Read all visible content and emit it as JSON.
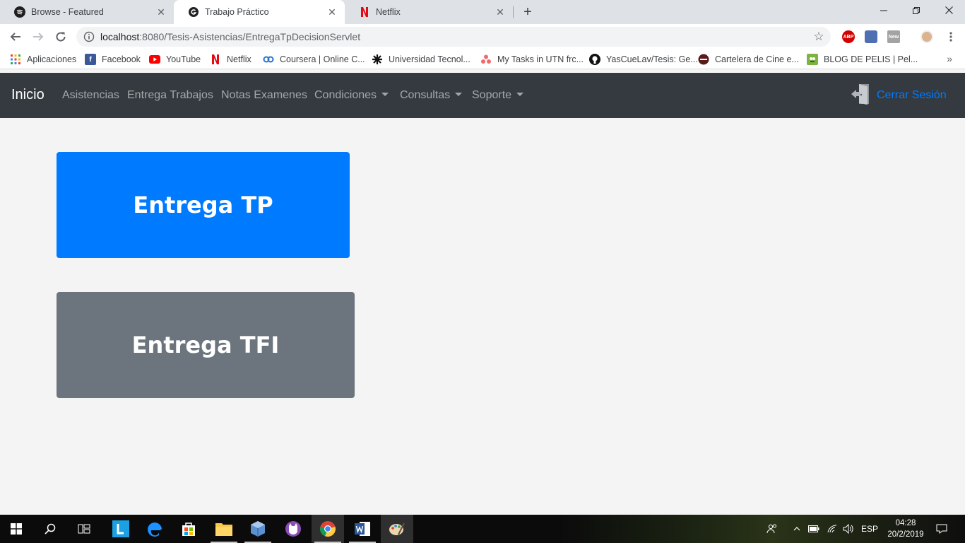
{
  "browser": {
    "tabs": [
      {
        "title": "Browse - Featured",
        "icon": "spotify-icon",
        "active": false
      },
      {
        "title": "Trabajo Práctico",
        "icon": "page-icon",
        "active": true
      },
      {
        "title": "Netflix",
        "icon": "netflix-icon",
        "active": false
      }
    ],
    "url_host": "localhost",
    "url_rest": ":8080/Tesis-Asistencias/EntregaTpDecisionServlet",
    "bookmarks": [
      {
        "label": "Aplicaciones",
        "icon": "apps-grid-icon"
      },
      {
        "label": "Facebook",
        "icon": "facebook-icon"
      },
      {
        "label": "YouTube",
        "icon": "youtube-icon"
      },
      {
        "label": "Netflix",
        "icon": "netflix-icon"
      },
      {
        "label": "Coursera | Online C...",
        "icon": "coursera-icon"
      },
      {
        "label": "Universidad Tecnol...",
        "icon": "utn-icon"
      },
      {
        "label": "My Tasks in UTN frc...",
        "icon": "asana-icon"
      },
      {
        "label": "YasCueLav/Tesis: Ge...",
        "icon": "github-icon"
      },
      {
        "label": "Cartelera de Cine e...",
        "icon": "cinema-icon"
      },
      {
        "label": "BLOG DE PELIS | Pel...",
        "icon": "blog-icon"
      }
    ],
    "extensions": {
      "abp": "ABP",
      "new": "New"
    }
  },
  "navbar": {
    "brand": "Inicio",
    "links": [
      {
        "label": "Asistencias",
        "dropdown": false
      },
      {
        "label": "Entrega Trabajos",
        "dropdown": false
      },
      {
        "label": "Notas Examenes",
        "dropdown": false
      },
      {
        "label": "Condiciones",
        "dropdown": true
      },
      {
        "label": "Consultas",
        "dropdown": true
      },
      {
        "label": "Soporte",
        "dropdown": true
      }
    ],
    "logout_label": "Cerrar Sesión"
  },
  "content": {
    "entrega_tp": "Entrega TP",
    "entrega_tfi": "Entrega TFI"
  },
  "taskbar": {
    "language": "ESP",
    "time": "04:28",
    "date": "20/2/2019"
  },
  "colors": {
    "navbar_bg": "#343a40",
    "primary": "#007bff",
    "secondary": "#6c757d",
    "page_bg": "#f4f4f4"
  }
}
